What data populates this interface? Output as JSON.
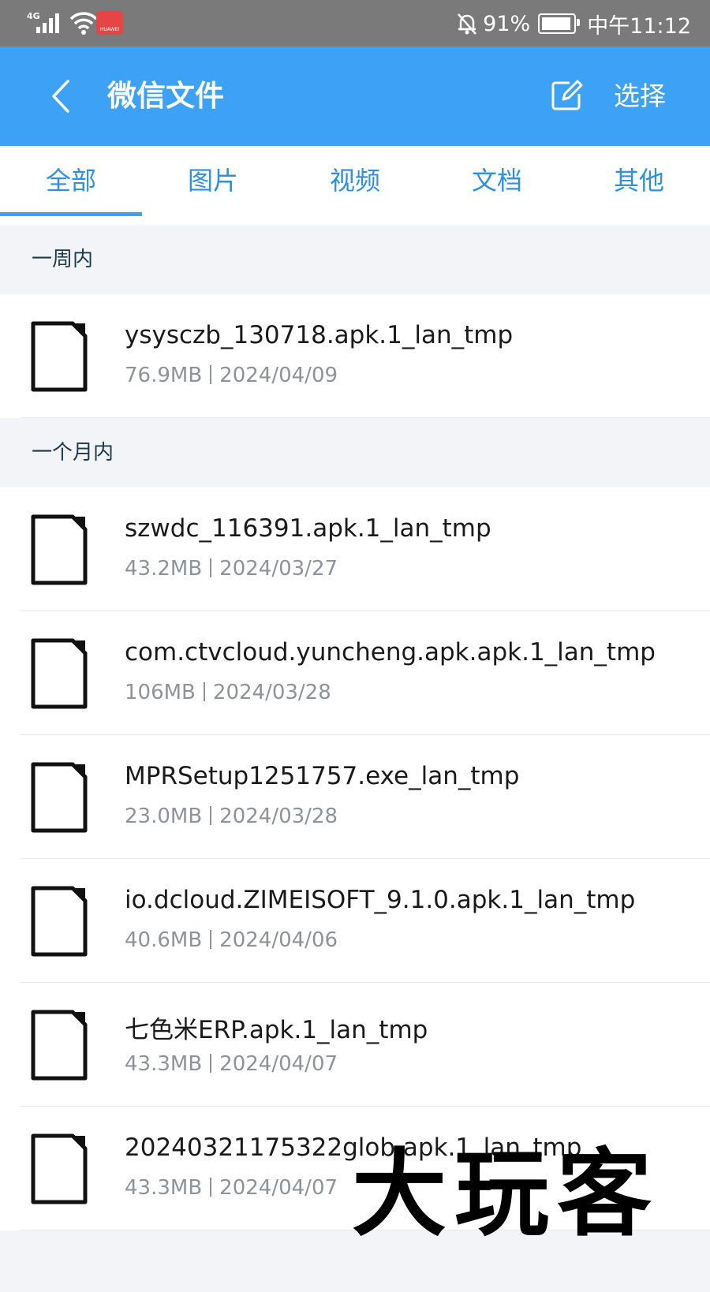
{
  "status": {
    "network": "4G",
    "battery_text": "91%",
    "time": "中午11:12",
    "app_badge": "HUAWEI"
  },
  "header": {
    "title": "微信文件",
    "select_label": "选择",
    "accent_color": "#3da1f5"
  },
  "tabs": [
    {
      "label": "全部",
      "active": true
    },
    {
      "label": "图片",
      "active": false
    },
    {
      "label": "视频",
      "active": false
    },
    {
      "label": "文档",
      "active": false
    },
    {
      "label": "其他",
      "active": false
    }
  ],
  "sections": [
    {
      "label": "一周内",
      "files": [
        {
          "name": "ysysczb_130718.apk.1_lan_tmp",
          "size": "76.9MB",
          "date": "2024/04/09"
        }
      ]
    },
    {
      "label": "一个月内",
      "files": [
        {
          "name": "szwdc_116391.apk.1_lan_tmp",
          "size": "43.2MB",
          "date": "2024/03/27"
        },
        {
          "name": "com.ctvcloud.yuncheng.apk.apk.1_lan_tmp",
          "size": "106MB",
          "date": "2024/03/28"
        },
        {
          "name": "MPRSetup1251757.exe_lan_tmp",
          "size": "23.0MB",
          "date": "2024/03/28"
        },
        {
          "name": "io.dcloud.ZIMEISOFT_9.1.0.apk.1_lan_tmp",
          "size": "40.6MB",
          "date": "2024/04/06"
        },
        {
          "name": "七色米ERP.apk.1_lan_tmp",
          "size": "43.3MB",
          "date": "2024/04/07"
        },
        {
          "name": "20240321175322glob.apk.1_lan_tmp",
          "size": "43.3MB",
          "date": "2024/04/07"
        }
      ]
    }
  ],
  "watermark": "大玩客"
}
